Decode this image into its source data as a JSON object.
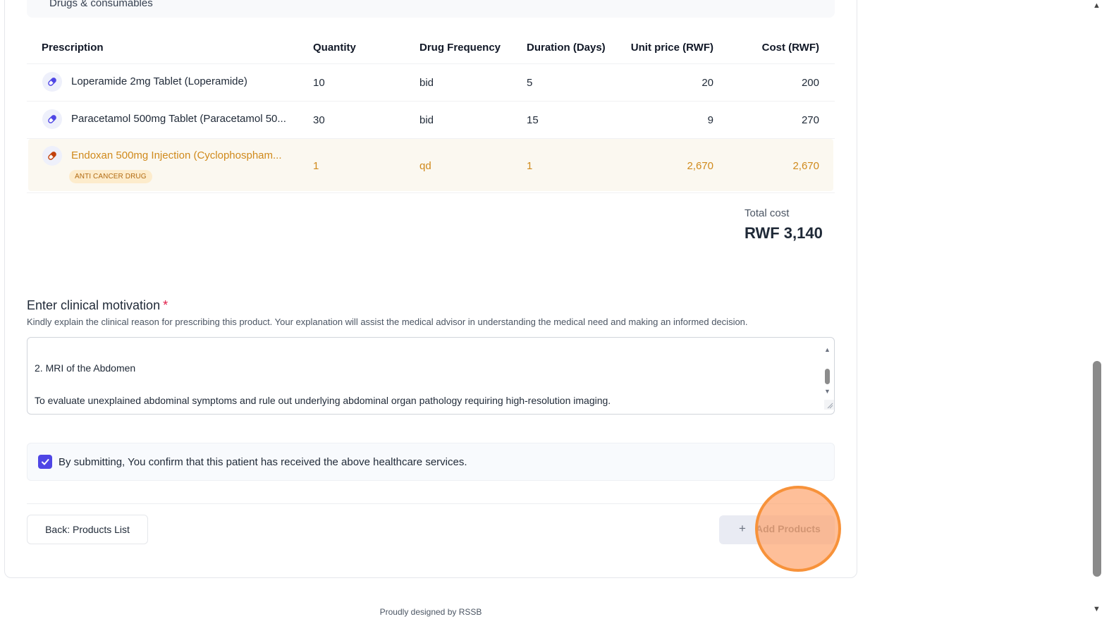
{
  "section": {
    "title": "Drugs & consumables"
  },
  "table": {
    "headers": {
      "prescription": "Prescription",
      "quantity": "Quantity",
      "frequency": "Drug Frequency",
      "duration": "Duration (Days)",
      "unit_price": "Unit price (RWF)",
      "cost": "Cost (RWF)"
    },
    "rows": [
      {
        "name": "Loperamide 2mg Tablet (Loperamide)",
        "quantity": "10",
        "frequency": "bid",
        "duration": "5",
        "unit_price": "20",
        "cost": "200",
        "icon": "pill-icon"
      },
      {
        "name": "Paracetamol 500mg Tablet (Paracetamol 50...",
        "quantity": "30",
        "frequency": "bid",
        "duration": "15",
        "unit_price": "9",
        "cost": "270",
        "icon": "pill-icon"
      },
      {
        "name": "Endoxan 500mg Injection (Cyclophospham...",
        "quantity": "1",
        "frequency": "qd",
        "duration": "1",
        "unit_price": "2,670",
        "cost": "2,670",
        "badge": "ANTI CANCER DRUG",
        "icon": "pill-icon",
        "highlight_color": "#d08a1c"
      }
    ]
  },
  "total": {
    "label": "Total cost",
    "value": "RWF 3,140"
  },
  "motivation": {
    "label": "Enter clinical motivation",
    "required_mark": "*",
    "help": "Kindly explain the clinical reason for prescribing this product. Your explanation will assist the medical advisor in understanding the medical need and making an informed decision.",
    "text_lines": [
      "2. MRI of the Abdomen",
      "To evaluate unexplained abdominal symptoms and rule out underlying abdominal organ pathology requiring high-resolution imaging."
    ]
  },
  "confirmation": {
    "checked": true,
    "text": "By submitting, You confirm that this patient has received the above healthcare services."
  },
  "actions": {
    "back_label": "Back: Products List",
    "add_plus": "+",
    "add_label": "Add Products"
  },
  "footer": {
    "text": "Proudly designed by RSSB"
  },
  "colors": {
    "accent": "#4f46e5",
    "warning": "#d08a1c",
    "click_marker": "#f7923a"
  }
}
